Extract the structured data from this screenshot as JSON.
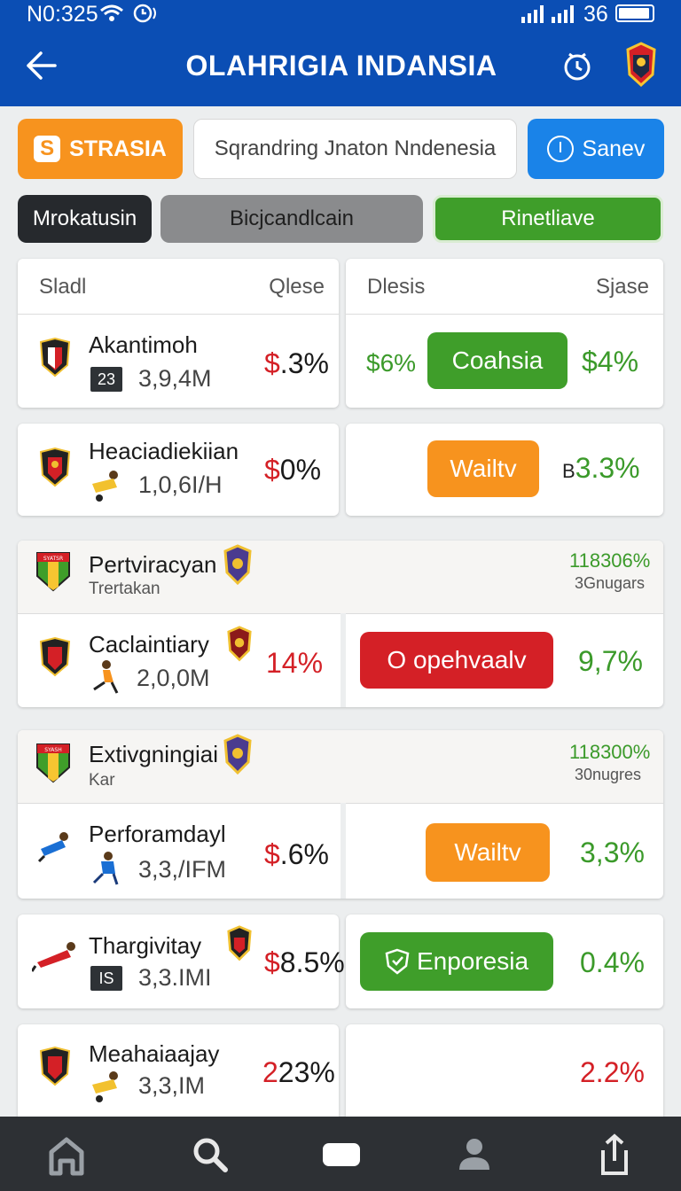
{
  "status_bar": {
    "time": "N0:325",
    "battery": "36"
  },
  "app_bar": {
    "title": "OLAHRIGIA INDANSIA"
  },
  "actions": {
    "orange_label": "STRASIA",
    "search_value": "Sqrandring  Jnaton Nndenesia",
    "blue_label": "Sanev"
  },
  "tabs": [
    "Mrokatusin",
    "Bicjcandlcain",
    "Rinetliave"
  ],
  "table": {
    "left_header": [
      "Sladl",
      "Qlese"
    ],
    "right_header": [
      "Dlesis",
      "Sjase"
    ]
  },
  "rows": [
    {
      "name": "Akantimoh",
      "code": "23",
      "sub": "3,9,4M",
      "pct": ".3%",
      "pct_prefix": "$",
      "left_value": "$6%",
      "pill": "Coahsia",
      "right_value": "$4%"
    },
    {
      "name": "Heaciadiekiian",
      "sub": "1,0,6I/H",
      "pct": "0%",
      "pct_prefix": "$",
      "pill": "Wailtv",
      "right_value": "3.3%",
      "right_prefix": "B"
    }
  ],
  "section1": {
    "name": "Pertviracyan",
    "sub": "Trertakan",
    "value": "118306%",
    "value_sub": "3Gnugars",
    "crest_text": "SYATSR",
    "row": {
      "name": "Caclaintiary",
      "sub": "2,0,0M",
      "pct": "14%",
      "pill": "O opehvaalv",
      "right_value": "9,7%"
    }
  },
  "section2": {
    "name": "Extivgningiai",
    "sub": "Kar",
    "value": "118300%",
    "value_sub": "30nugres",
    "crest_text": "SYASH",
    "rows": [
      {
        "name": "Perforamdayl",
        "sub": "3,3,/IFM",
        "pct": ".6%",
        "pct_prefix": "$",
        "pill": "Wailtv",
        "right_value": "3,3%"
      },
      {
        "name": "Thargivitay",
        "code": "IS",
        "sub": "3,3.IMI",
        "pct": "8.5%",
        "pct_prefix": "$",
        "pill": "Enporesia",
        "right_value": "0.4%"
      },
      {
        "name": "Meahaiaajay",
        "sub": "3,3,IM",
        "pct": "23%",
        "pct_prefix": "2",
        "right_value": "2.2%"
      }
    ]
  },
  "colors": {
    "brand_blue": "#0b4eb4",
    "green": "#3f9e2a",
    "orange": "#f7931e",
    "red": "#d42026",
    "dark": "#26292d"
  },
  "icons": [
    "back-arrow-icon",
    "clock-search-icon",
    "crest-icon",
    "home-icon",
    "search-icon",
    "chat-icon",
    "profile-icon",
    "share-icon"
  ]
}
